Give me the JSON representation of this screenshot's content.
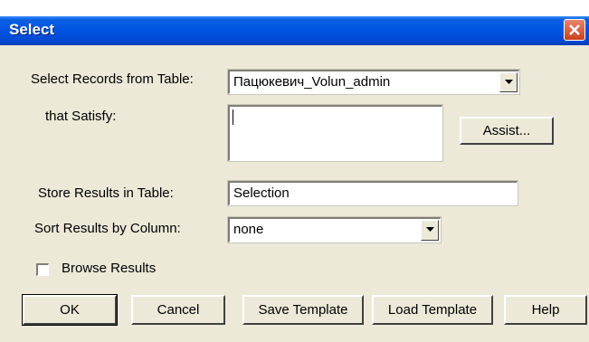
{
  "window": {
    "title": "Select"
  },
  "select_table": {
    "label": "Select Records from Table:",
    "value": "Пацюкевич_Volun_admin"
  },
  "satisfy": {
    "label": "that Satisfy:",
    "value": "",
    "assist_label": "Assist..."
  },
  "store": {
    "label": "Store Results in Table:",
    "value": "Selection"
  },
  "sort": {
    "label": "Sort Results by Column:",
    "value": "none"
  },
  "browse": {
    "label": "Browse Results",
    "checked": false
  },
  "buttons": {
    "ok": "OK",
    "cancel": "Cancel",
    "save_template": "Save Template",
    "load_template": "Load Template",
    "help": "Help"
  }
}
